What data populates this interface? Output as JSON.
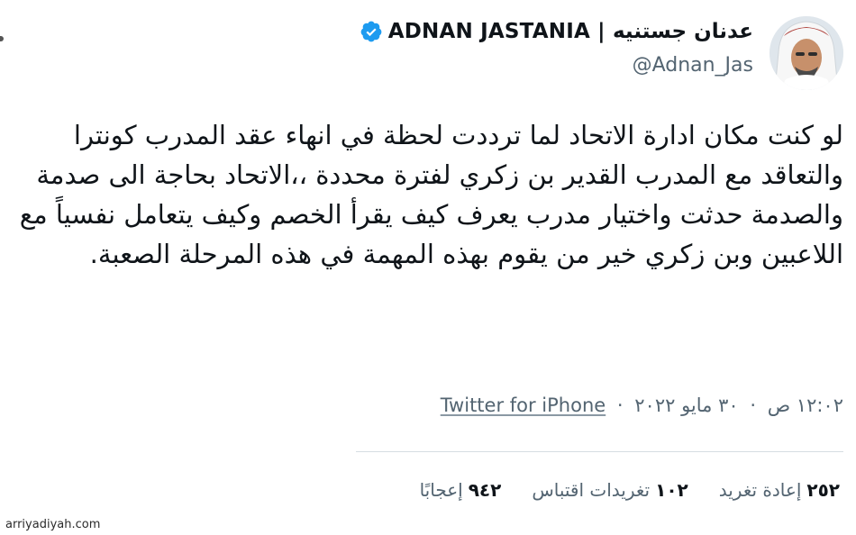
{
  "header": {
    "display_name": "ADNAN JASTANIA | عدنان جستنيه",
    "handle": "@Adnan_Jas",
    "avatar_icon": "avatar-portrait-icon",
    "verified_icon": "verified-badge-icon",
    "verified_color": "#1d9bf0"
  },
  "tweet": {
    "text": "لو كنت مكان ادارة الاتحاد لما ترددت لحظة في انهاء عقد المدرب كونترا والتعاقد مع المدرب القدير بن زكري لفترة محددة ،،الاتحاد بحاجة الى صدمة والصدمة حدثت واختيار مدرب يعرف كيف يقرأ الخصم وكيف يتعامل نفسياً مع اللاعبين وبن زكري خير من يقوم بهذه المهمة في هذه المرحلة الصعبة."
  },
  "meta": {
    "time": "١٢:٠٢ ص",
    "date": "٣٠ مايو ٢٠٢٢",
    "separator": "·",
    "source": "Twitter for iPhone"
  },
  "stats": {
    "retweets_count": "٢٥٢",
    "retweets_label": "إعادة تغريد",
    "quotes_count": "١٠٢",
    "quotes_label": "تغريدات اقتباس",
    "likes_count": "٩٤٢",
    "likes_label": "إعجابًا"
  },
  "watermark": "arriyadiyah.com"
}
